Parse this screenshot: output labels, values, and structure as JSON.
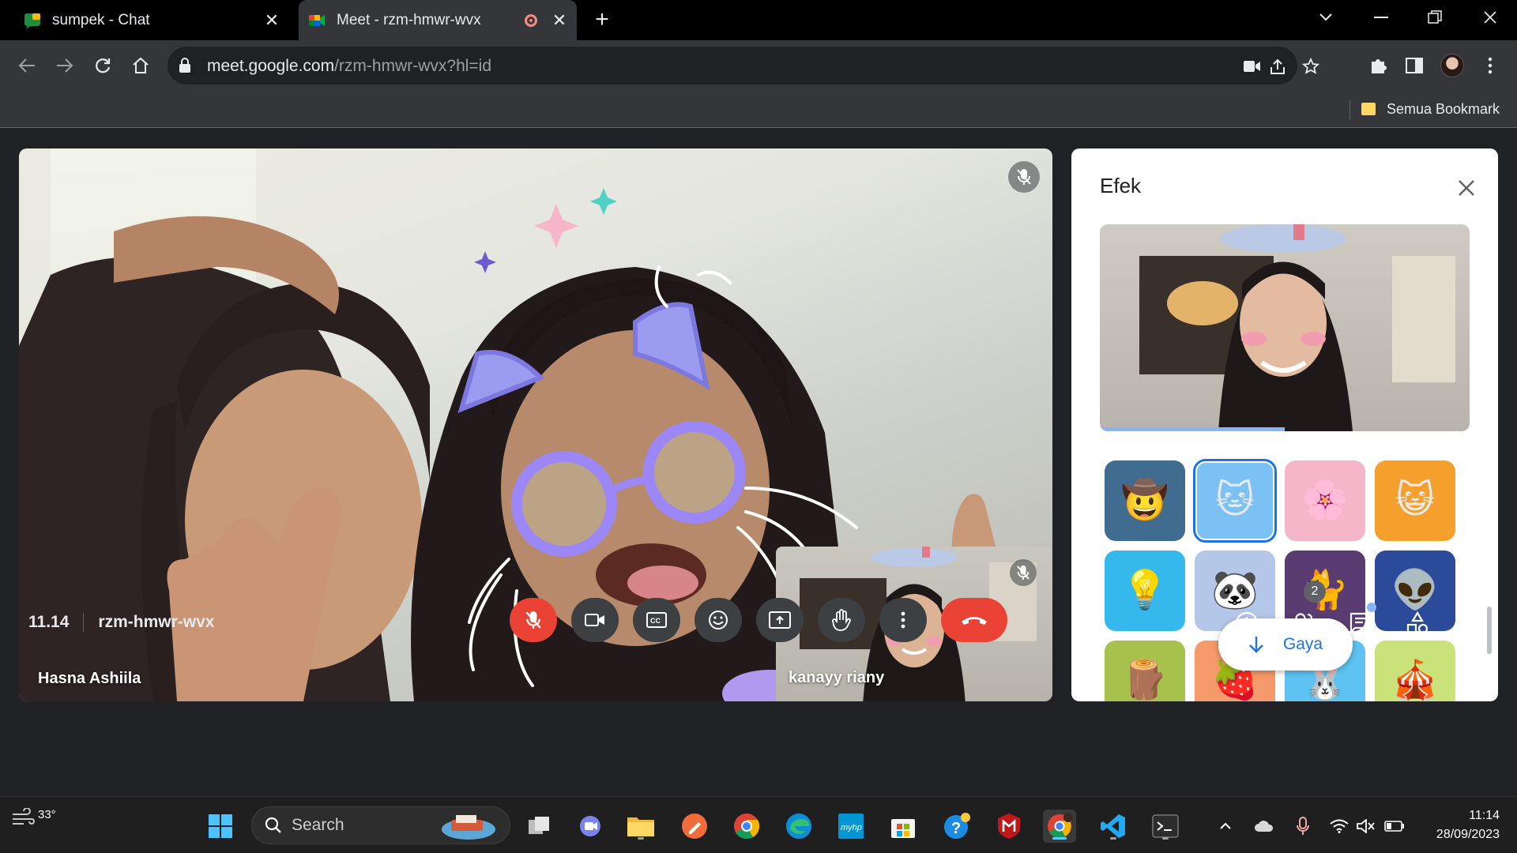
{
  "browser": {
    "tabs": [
      {
        "title": "sumpek - Chat",
        "close": "✕"
      },
      {
        "title": "Meet - rzm-hmwr-wvx",
        "close": "✕"
      }
    ],
    "new_tab": "+",
    "url_host": "meet.google.com",
    "url_path": "/rzm-hmwr-wvx?hl=id",
    "bookmark": "Semua Bookmark",
    "window_controls": [
      "chevron-down-icon",
      "minimize-icon",
      "restore-icon",
      "close-icon"
    ]
  },
  "meeting": {
    "main_participant": "Hasna Ashiila",
    "self_participant": "kanayy riany",
    "time": "11.14",
    "code": "rzm-hmwr-wvx",
    "people_count": "2"
  },
  "effects_panel": {
    "title": "Efek",
    "style_button": "Gaya",
    "preview_progress": 0.5,
    "tiles": [
      {
        "name": "cowboy-hat",
        "emoji": "🤠"
      },
      {
        "name": "flying-cat",
        "emoji": "🐱",
        "selected": true
      },
      {
        "name": "cherry-blossom",
        "emoji": "🌸"
      },
      {
        "name": "cat-face",
        "emoji": "😺"
      },
      {
        "name": "lightbulb",
        "emoji": "💡"
      },
      {
        "name": "panda",
        "emoji": "🐼"
      },
      {
        "name": "black-cat",
        "emoji": "🐈"
      },
      {
        "name": "alien-dome",
        "emoji": "👽"
      },
      {
        "name": "tree-stump",
        "emoji": "🪵"
      },
      {
        "name": "strawberry",
        "emoji": "🍓"
      },
      {
        "name": "blue-creature",
        "emoji": "🐰"
      },
      {
        "name": "tent",
        "emoji": "🎪"
      }
    ]
  },
  "taskbar": {
    "temperature": "33°",
    "search_placeholder": "Search",
    "time": "11:14",
    "date": "28/09/2023"
  },
  "colors": {
    "accent_blue": "#1a73e8",
    "end_call_red": "#ea4335",
    "chrome_dark": "#35363a",
    "meet_bg": "#202124"
  }
}
